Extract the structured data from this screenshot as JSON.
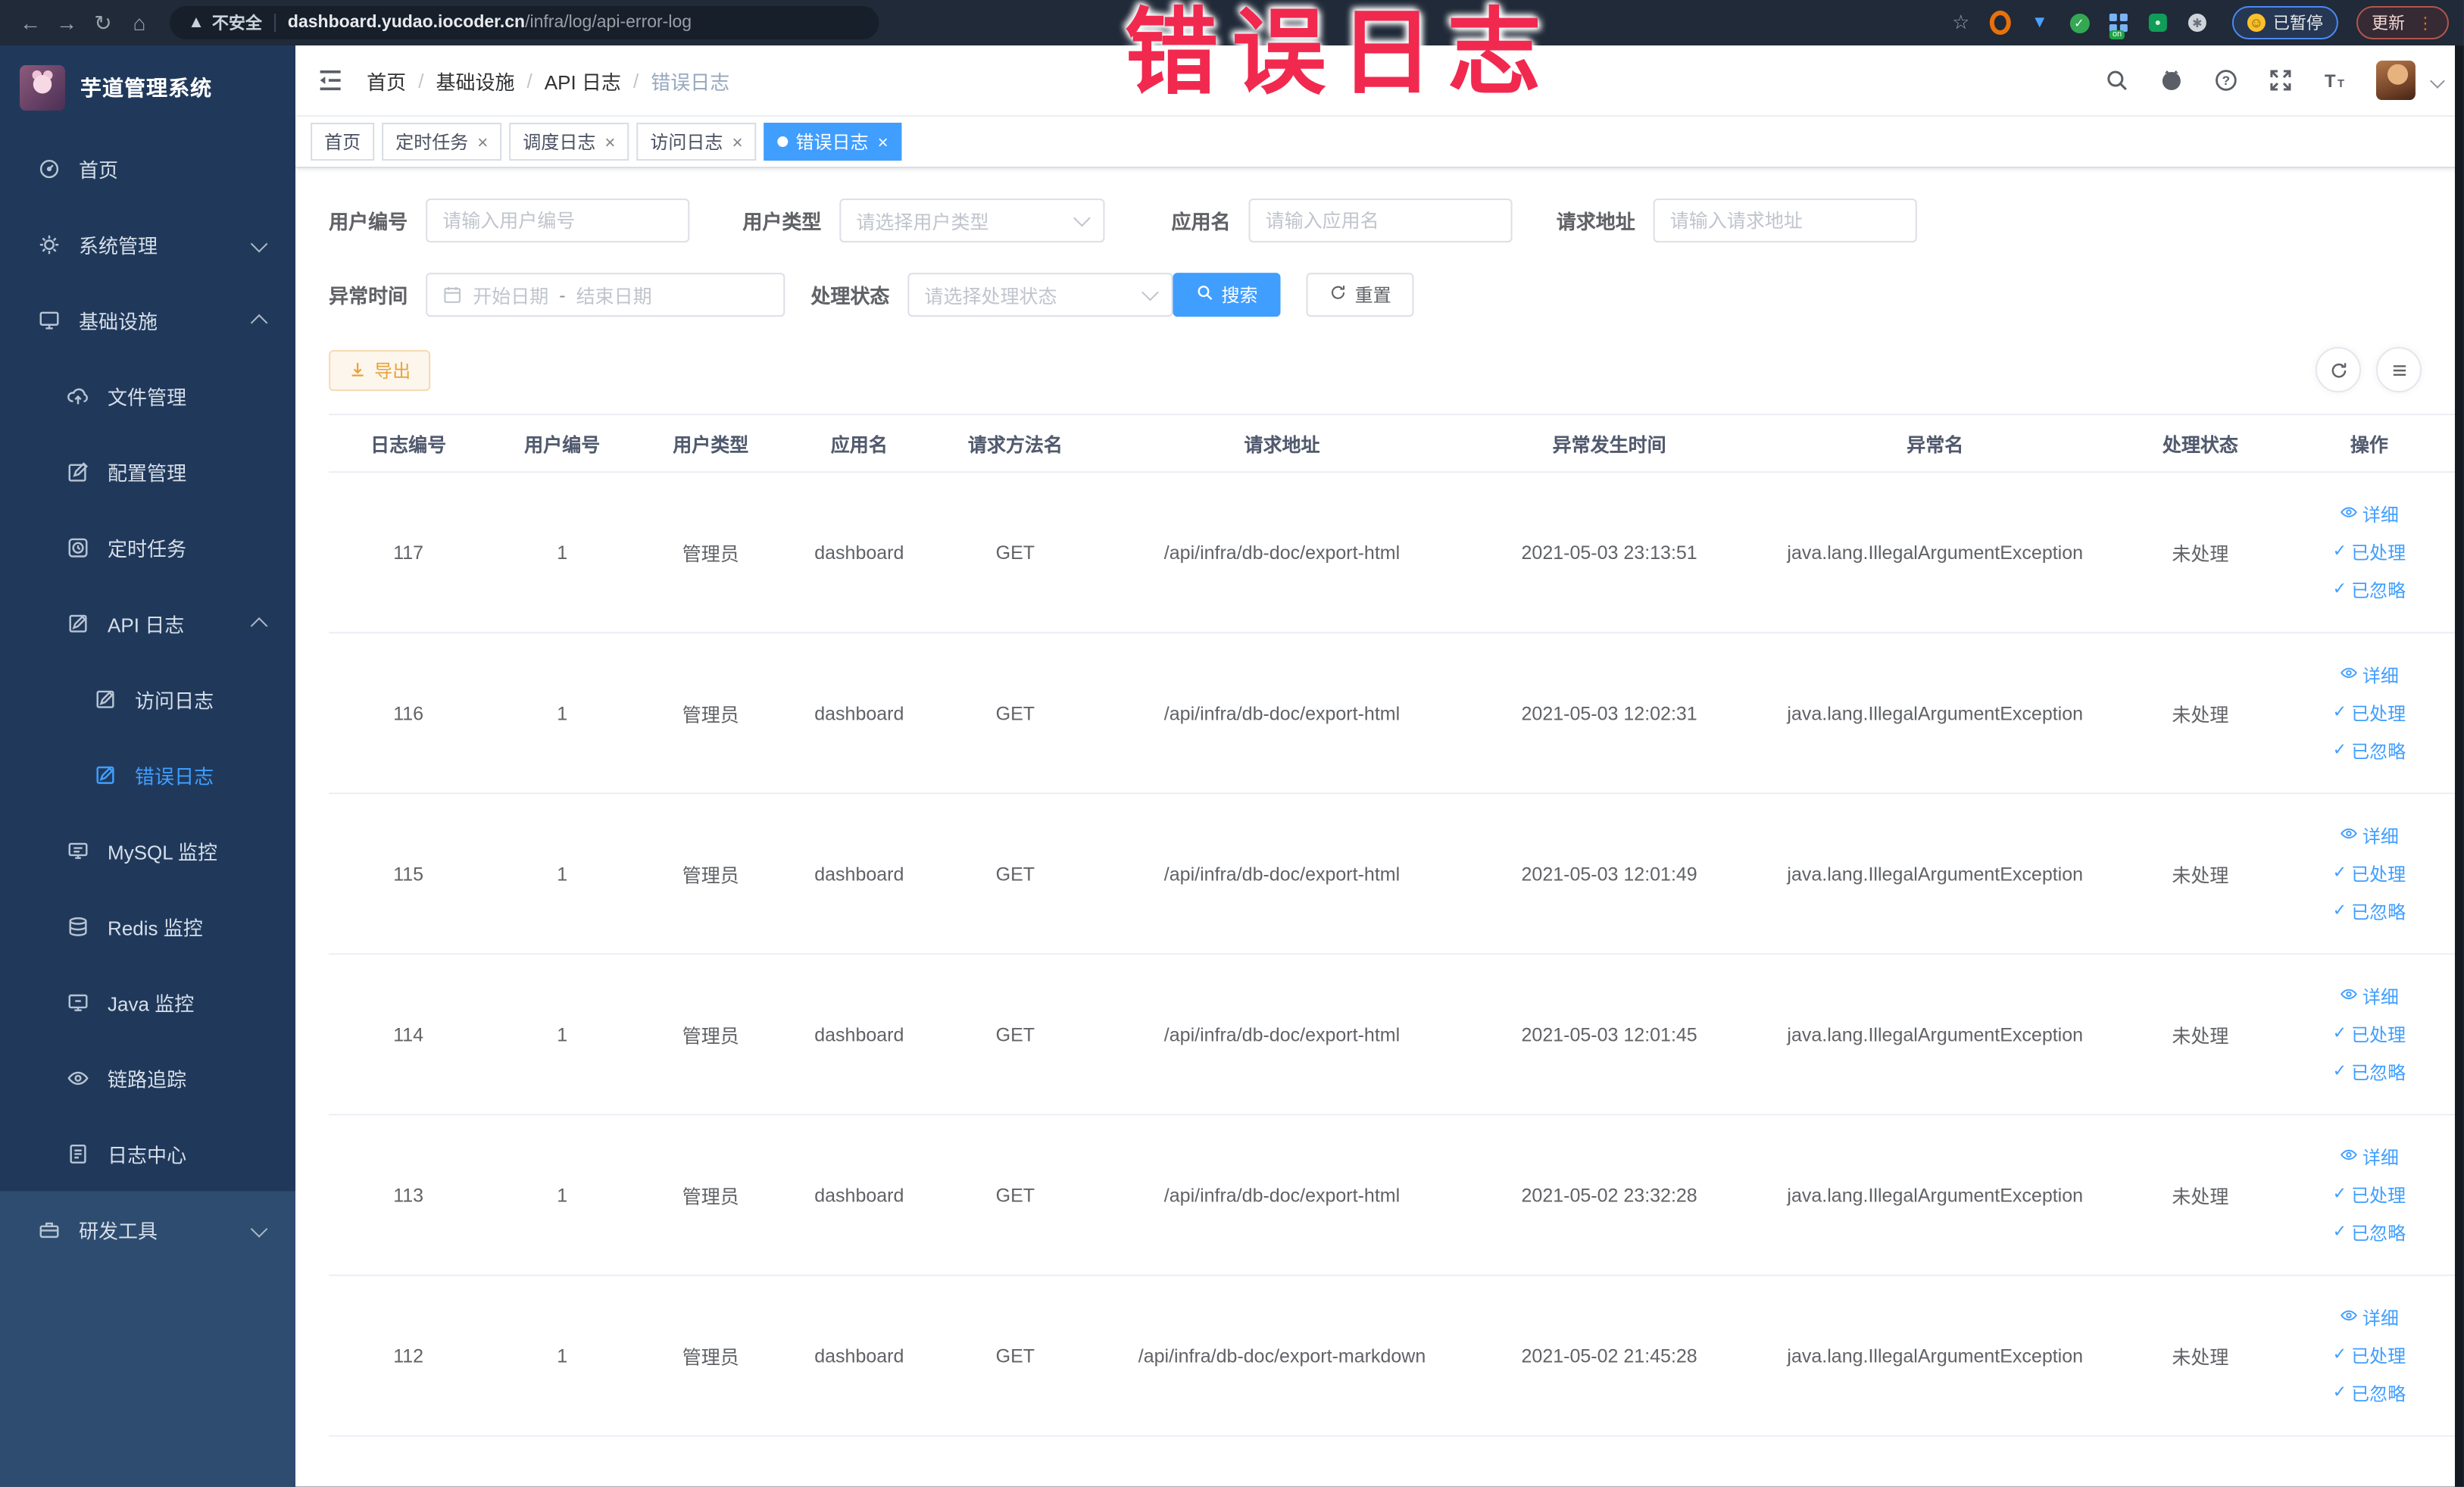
{
  "colors": {
    "primary": "#409eff",
    "annotation_red": "#f1294f",
    "export_warning": "#e6a23c",
    "sidebar_bg": "#20395b",
    "sidebar_bg_light": "#2d4c70",
    "browser_bar": "#202a38"
  },
  "browser": {
    "security": "不安全",
    "url_host": "dashboard.yudao.iocoder.cn",
    "url_path": "/infra/log/api-error-log",
    "paused_badge": "已暂停",
    "update_button": "更新"
  },
  "annotation": {
    "text": "错误日志"
  },
  "sidebar": {
    "logo_title": "芋道管理系统",
    "items": [
      {
        "label": "首页",
        "icon": "dashboard-icon",
        "depth": 0
      },
      {
        "label": "系统管理",
        "icon": "gear-icon",
        "depth": 0,
        "chevron": "down"
      },
      {
        "label": "基础设施",
        "icon": "infra-icon",
        "depth": 0,
        "chevron": "up"
      },
      {
        "label": "文件管理",
        "icon": "cloud-upload-icon",
        "depth": 1
      },
      {
        "label": "配置管理",
        "icon": "config-edit-icon",
        "depth": 1
      },
      {
        "label": "定时任务",
        "icon": "timer-icon",
        "depth": 1
      },
      {
        "label": "API 日志",
        "icon": "api-log-icon",
        "depth": 1,
        "chevron": "up"
      },
      {
        "label": "访问日志",
        "icon": "access-log-icon",
        "depth": 2
      },
      {
        "label": "错误日志",
        "icon": "error-log-icon",
        "depth": 2,
        "active": true
      },
      {
        "label": "MySQL 监控",
        "icon": "mysql-monitor-icon",
        "depth": 1
      },
      {
        "label": "Redis 监控",
        "icon": "redis-monitor-icon",
        "depth": 1
      },
      {
        "label": "Java 监控",
        "icon": "java-monitor-icon",
        "depth": 1
      },
      {
        "label": "链路追踪",
        "icon": "trace-eye-icon",
        "depth": 1
      },
      {
        "label": "日志中心",
        "icon": "log-center-icon",
        "depth": 1
      },
      {
        "label": "研发工具",
        "icon": "toolbox-icon",
        "depth": 0,
        "chevron": "down",
        "section": "light"
      }
    ]
  },
  "header": {
    "breadcrumb": [
      "首页",
      "基础设施",
      "API 日志",
      "错误日志"
    ]
  },
  "tabs": [
    {
      "label": "首页"
    },
    {
      "label": "定时任务",
      "closable": true
    },
    {
      "label": "调度日志",
      "closable": true
    },
    {
      "label": "访问日志",
      "closable": true
    },
    {
      "label": "错误日志",
      "closable": true,
      "active": true
    }
  ],
  "filters": {
    "rows": [
      [
        {
          "label": "用户编号",
          "type": "input",
          "placeholder": "请输入用户编号"
        },
        {
          "label": "用户类型",
          "type": "select",
          "placeholder": "请选择用户类型"
        },
        {
          "label": "应用名",
          "type": "input",
          "placeholder": "请输入应用名"
        },
        {
          "label": "请求地址",
          "type": "input",
          "placeholder": "请输入请求地址"
        }
      ],
      [
        {
          "label": "异常时间",
          "type": "daterange",
          "start_placeholder": "开始日期",
          "separator": "-",
          "end_placeholder": "结束日期"
        },
        {
          "label": "处理状态",
          "type": "select",
          "placeholder": "请选择处理状态"
        }
      ]
    ],
    "search_label": "搜索",
    "reset_label": "重置"
  },
  "toolbar": {
    "export_label": "导出"
  },
  "table": {
    "headers": [
      "日志编号",
      "用户编号",
      "用户类型",
      "应用名",
      "请求方法名",
      "请求地址",
      "异常发生时间",
      "异常名",
      "处理状态",
      "操作"
    ],
    "row_actions": [
      "详细",
      "已处理",
      "已忽略"
    ],
    "rows": [
      [
        "117",
        "1",
        "管理员",
        "dashboard",
        "GET",
        "/api/infra/db-doc/export-html",
        "2021-05-03 23:13:51",
        "java.lang.IllegalArgumentException",
        "未处理"
      ],
      [
        "116",
        "1",
        "管理员",
        "dashboard",
        "GET",
        "/api/infra/db-doc/export-html",
        "2021-05-03 12:02:31",
        "java.lang.IllegalArgumentException",
        "未处理"
      ],
      [
        "115",
        "1",
        "管理员",
        "dashboard",
        "GET",
        "/api/infra/db-doc/export-html",
        "2021-05-03 12:01:49",
        "java.lang.IllegalArgumentException",
        "未处理"
      ],
      [
        "114",
        "1",
        "管理员",
        "dashboard",
        "GET",
        "/api/infra/db-doc/export-html",
        "2021-05-03 12:01:45",
        "java.lang.IllegalArgumentException",
        "未处理"
      ],
      [
        "113",
        "1",
        "管理员",
        "dashboard",
        "GET",
        "/api/infra/db-doc/export-html",
        "2021-05-02 23:32:28",
        "java.lang.IllegalArgumentException",
        "未处理"
      ],
      [
        "112",
        "1",
        "管理员",
        "dashboard",
        "GET",
        "/api/infra/db-doc/export-markdown",
        "2021-05-02 21:45:28",
        "java.lang.IllegalArgumentException",
        "未处理"
      ]
    ]
  }
}
